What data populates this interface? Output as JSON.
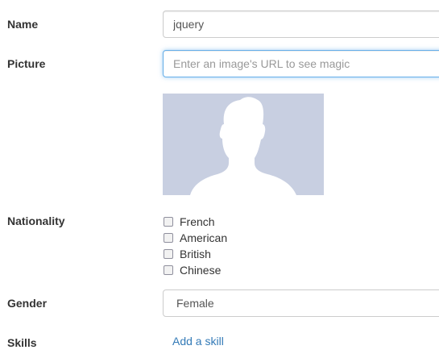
{
  "form": {
    "name": {
      "label": "Name",
      "value": "jquery"
    },
    "picture": {
      "label": "Picture",
      "placeholder": "Enter an image's URL to see magic"
    },
    "nationality": {
      "label": "Nationality",
      "options": [
        "French",
        "American",
        "British",
        "Chinese"
      ]
    },
    "gender": {
      "label": "Gender",
      "selected": "Female"
    },
    "skills": {
      "label": "Skills",
      "add_link": "Add a skill"
    }
  },
  "icons": {
    "avatar": "default-user-silhouette-icon"
  },
  "colors": {
    "avatar_bg": "#c8cfe1",
    "focus": "#66afe9",
    "link": "#337ab7"
  }
}
